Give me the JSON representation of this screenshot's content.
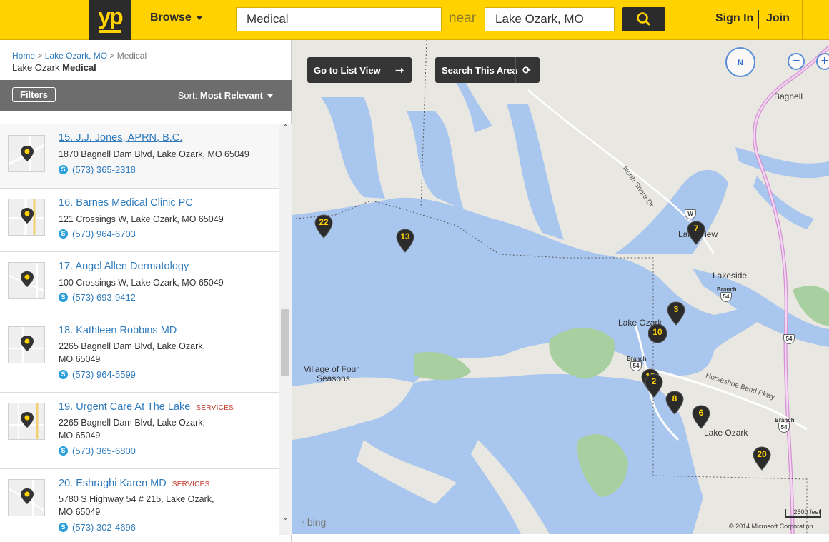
{
  "header": {
    "logo": "yp",
    "browse_label": "Browse",
    "search_query": "Medical",
    "near_label": "near",
    "location": "Lake Ozark, MO",
    "sign_in": "Sign In",
    "join": "Join"
  },
  "breadcrumb": {
    "home": "Home",
    "sep": ">",
    "city": "Lake Ozark, MO",
    "category": "Medical"
  },
  "page_title": {
    "city": "Lake Ozark",
    "category": "Medical"
  },
  "toolbar": {
    "filters_label": "Filters",
    "sort_prefix": "Sort:",
    "sort_value": "Most Relevant"
  },
  "results": [
    {
      "num": "15.",
      "name": "J.J. Jones, APRN, B.C.",
      "badge": "",
      "address": "1870 Bagnell Dam Blvd, Lake Ozark, MO 65049",
      "phone": "(573) 365-2318"
    },
    {
      "num": "16.",
      "name": "Barnes Medical Clinic PC",
      "badge": "",
      "address": "121 Crossings W, Lake Ozark, MO 65049",
      "phone": "(573) 964-6703"
    },
    {
      "num": "17.",
      "name": "Angel Allen Dermatology",
      "badge": "",
      "address": "100 Crossings W, Lake Ozark, MO 65049",
      "phone": "(573) 693-9412"
    },
    {
      "num": "18.",
      "name": "Kathleen Robbins MD",
      "badge": "",
      "address_line1": "2265 Bagnell Dam Blvd, Lake Ozark,",
      "address_line2": "MO 65049",
      "phone": "(573) 964-5599"
    },
    {
      "num": "19.",
      "name": "Urgent Care At The Lake",
      "badge": "SERVICES",
      "address_line1": "2265 Bagnell Dam Blvd, Lake Ozark,",
      "address_line2": "MO 65049",
      "phone": "(573) 365-6800"
    },
    {
      "num": "20.",
      "name": "Eshraghi Karen MD",
      "badge": "SERVICES",
      "address_line1": "5780 S Highway 54 # 215, Lake Ozark,",
      "address_line2": "MO 65049",
      "phone": "(573) 302-4696"
    }
  ],
  "map": {
    "list_view_button": "Go to List View",
    "search_area_button": "Search This Area",
    "compass_label": "N",
    "zoom_out": "−",
    "zoom_in": "+",
    "places": {
      "bagnell": "Bagnell",
      "lake_view": "Lake View",
      "lakeside": "Lakeside",
      "lake_ozark_1": "Lake Ozark",
      "lake_ozark_2": "Lake Ozark",
      "village_1": "Village of Four",
      "village_2": "Seasons"
    },
    "roads": {
      "north_shore": "North Shore Dr",
      "horseshoe": "Horseshoe Bend Pkwy",
      "w_route": "W",
      "branch": "Branch",
      "hwy54": "54"
    },
    "pins": [
      "22",
      "13",
      "7",
      "3",
      "10",
      "12",
      "2",
      "8",
      "6",
      "20"
    ],
    "bing_label": "bing",
    "scale_label": "2500 feet",
    "copyright": "© 2014 Microsoft Corporation"
  },
  "colors": {
    "brand_yellow": "#ffd200",
    "link_blue": "#2f7bbd",
    "water": "#a9c6ee",
    "land": "#e9e7e1",
    "park": "#a8cfa0"
  }
}
